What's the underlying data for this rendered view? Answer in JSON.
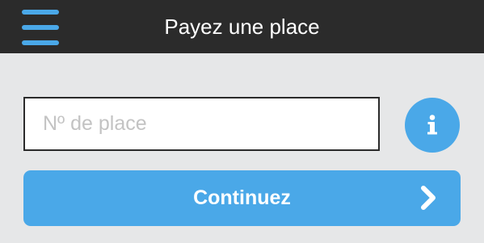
{
  "header": {
    "title": "Payez une place",
    "menu_icon": "hamburger-menu-icon"
  },
  "form": {
    "place_placeholder": "Nº de place",
    "place_value": "",
    "info_icon": "info-icon"
  },
  "actions": {
    "continue_label": "Continuez",
    "continue_icon": "chevron-right-icon"
  },
  "colors": {
    "header_background": "#2b2b2b",
    "accent": "#4aa8e8",
    "page_background": "#e6e7e8"
  }
}
